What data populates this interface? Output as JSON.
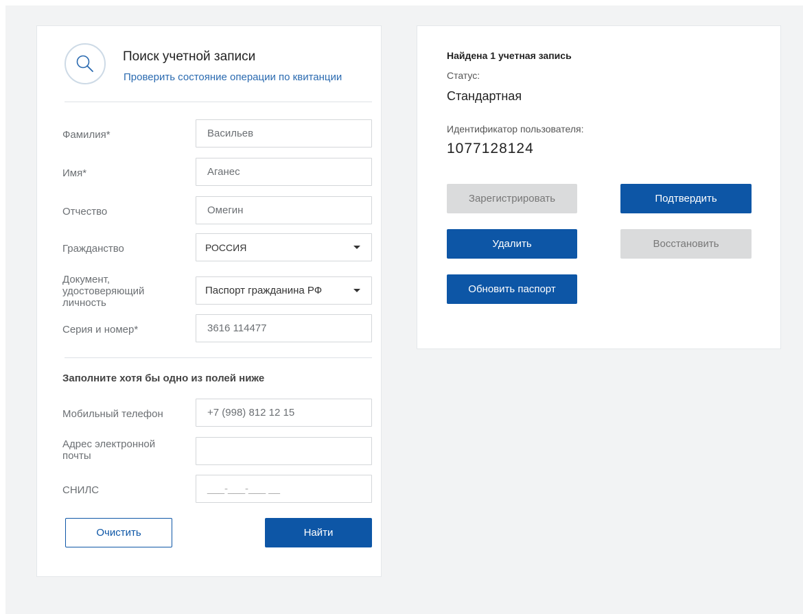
{
  "search_form": {
    "title": "Поиск учетной записи",
    "check_link": "Проверить состояние операции по квитанции",
    "fields": {
      "last_name": {
        "label": "Фамилия*",
        "value": "Васильев"
      },
      "first_name": {
        "label": "Имя*",
        "value": "Аганес"
      },
      "patronymic": {
        "label": "Отчество",
        "value": "Омегин"
      },
      "citizenship": {
        "label": "Гражданство",
        "value": "РОССИЯ"
      },
      "document": {
        "label": "Документ, удостоверяющий личность",
        "value": "Паспорт гражданина РФ"
      },
      "series_number": {
        "label": "Серия и номер*",
        "value": "3616 114477"
      }
    },
    "optional_title": "Заполните хотя бы одно из полей ниже",
    "optional_fields": {
      "phone": {
        "label": "Мобильный телефон",
        "value": "+7 (998) 812 12 15"
      },
      "email": {
        "label": "Адрес электронной почты",
        "value": ""
      },
      "snils": {
        "label": "СНИЛС",
        "value": "___-___-___ __"
      }
    },
    "clear_button": "Очистить",
    "find_button": "Найти"
  },
  "result": {
    "found_text": "Найдена 1 учетная запись",
    "status_label": "Статус:",
    "status_value": "Стандартная",
    "id_label": "Идентификатор пользователя:",
    "id_value": "1077128124",
    "buttons": {
      "register": "Зарегистрировать",
      "confirm": "Подтвердить",
      "delete": "Удалить",
      "restore": "Восстановить",
      "update_passport": "Обновить паспорт"
    }
  },
  "colors": {
    "primary": "#0d56a6",
    "link": "#2a6ab0",
    "disabled_bg": "#dadbdc",
    "page_bg": "#f2f3f4"
  },
  "icons": {
    "search": "magnifier-icon",
    "dropdown": "caret-down-icon"
  }
}
